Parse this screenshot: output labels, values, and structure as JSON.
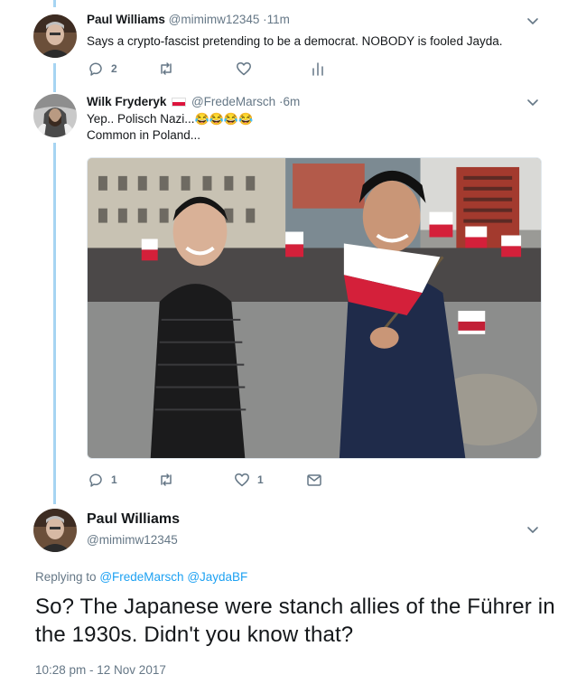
{
  "tweet1": {
    "name": "Paul Williams",
    "handle": "@mimimw12345",
    "time": "11m",
    "text": "Says a crypto-fascist pretending to be a democrat. NOBODY is fooled Jayda.",
    "reply_count": "2",
    "retweet_count": "",
    "like_count": ""
  },
  "tweet2": {
    "name": "Wilk Fryderyk",
    "flag": "poland-flag",
    "handle": "@FredeMarsch",
    "time": "6m",
    "text_line1": "Yep.. Polisch Nazi...",
    "emojis": "😂😂😂😂",
    "text_line2": "Common in Poland...",
    "reply_count": "1",
    "retweet_count": "",
    "like_count": "1"
  },
  "main": {
    "name": "Paul Williams",
    "handle": "@mimimw12345",
    "replying_prefix": "Replying to",
    "reply_to_1": "@FredeMarsch",
    "reply_to_2": "@JaydaBF",
    "text": "So? The Japanese were stanch allies of the Führer in the 1930s. Didn't you know that?",
    "timestamp": "10:28 pm - 12 Nov 2017"
  },
  "icons": {
    "reply": "reply-icon",
    "retweet": "retweet-icon",
    "like": "heart-icon",
    "analytics": "analytics-icon",
    "dm": "envelope-icon",
    "more": "chevron-down-icon"
  },
  "colors": {
    "accent": "#1da1f2",
    "muted": "#657786",
    "thread_line": "#a6d4f2",
    "text": "#14171a"
  }
}
